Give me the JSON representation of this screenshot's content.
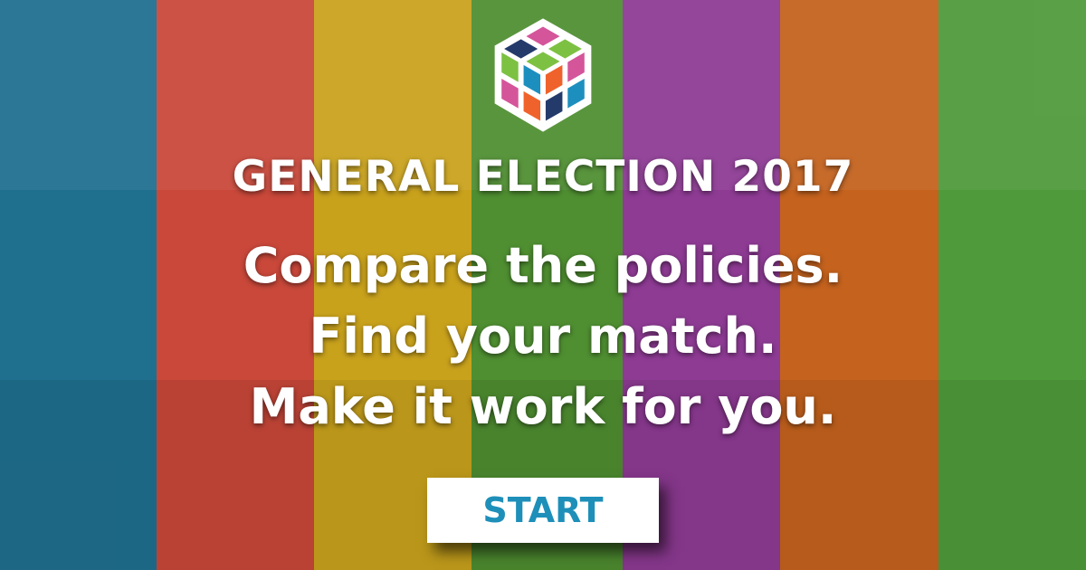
{
  "stripes": [
    "#1f6f8f",
    "#c9483a",
    "#c9a21c",
    "#4f8f31",
    "#8e3b94",
    "#c4621e",
    "#4f9a3a"
  ],
  "logo_colors": {
    "navy": "#243a6b",
    "pink": "#d4559a",
    "green": "#7dc143",
    "blue": "#1d8fbf",
    "orange": "#f0622b"
  },
  "title": "GENERAL ELECTION 2017",
  "taglines": [
    "Compare the policies.",
    "Find your match.",
    "Make it work for you."
  ],
  "start_label": "START"
}
